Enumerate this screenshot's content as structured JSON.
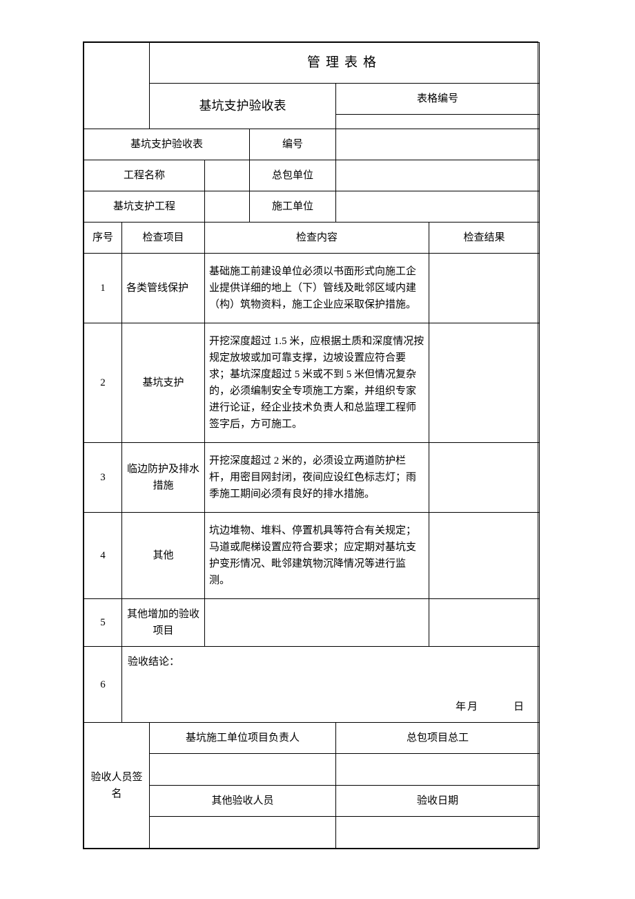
{
  "header": {
    "title": "管理表格",
    "subtitle": "基坑支护验收表",
    "form_no_label": "表格编号",
    "form_no_value": ""
  },
  "meta_rows": [
    {
      "c1": "基坑支护验收表",
      "c2": "",
      "c3": "编号",
      "c4": ""
    },
    {
      "c1": "工程名称",
      "c2": "",
      "c3": "总包单位",
      "c4": ""
    },
    {
      "c1": "基坑支护工程",
      "c2": "",
      "c3": "施工单位",
      "c4": ""
    }
  ],
  "columns": {
    "no": "序号",
    "item": "检查项目",
    "content": "检查内容",
    "result": "检查结果"
  },
  "rows": [
    {
      "no": "1",
      "item": "各类管线保护",
      "content": "基础施工前建设单位必须以书面形式向施工企业提供详细的地上（下）管线及毗邻区域内建（构）筑物资料，施工企业应采取保护措施。",
      "result": ""
    },
    {
      "no": "2",
      "item": "基坑支护",
      "content": "开挖深度超过 1.5 米，应根据土质和深度情况按规定放坡或加可靠支撑，边坡设置应符合要求；基坑深度超过 5 米或不到 5 米但情况复杂的，必须编制安全专项施工方案，并组织专家进行论证，经企业技术负责人和总监理工程师签字后，方可施工。",
      "result": ""
    },
    {
      "no": "3",
      "item": "临边防护及排水措施",
      "content": "开挖深度超过 2 米的，必须设立两道防护栏杆，用密目网封闭，夜间应设红色标志灯；雨季施工期间必须有良好的排水措施。",
      "result": ""
    },
    {
      "no": "4",
      "item": "其他",
      "content": "坑边堆物、堆料、停置机具等符合有关规定；马道或爬梯设置应符合要求；应定期对基坑支护变形情况、毗邻建筑物沉降情况等进行监测。",
      "result": ""
    },
    {
      "no": "5",
      "item": "其他增加的验收项目",
      "content": "",
      "result": ""
    }
  ],
  "conclusion": {
    "no": "6",
    "label": "验收结论：",
    "year": "年",
    "month": "月",
    "day": "日"
  },
  "sign": {
    "side_label": "验收人员签名",
    "h1": "基坑施工单位项目负责人",
    "h2": "总包项目总工",
    "h3": "其他验收人员",
    "h4": "验收日期"
  }
}
